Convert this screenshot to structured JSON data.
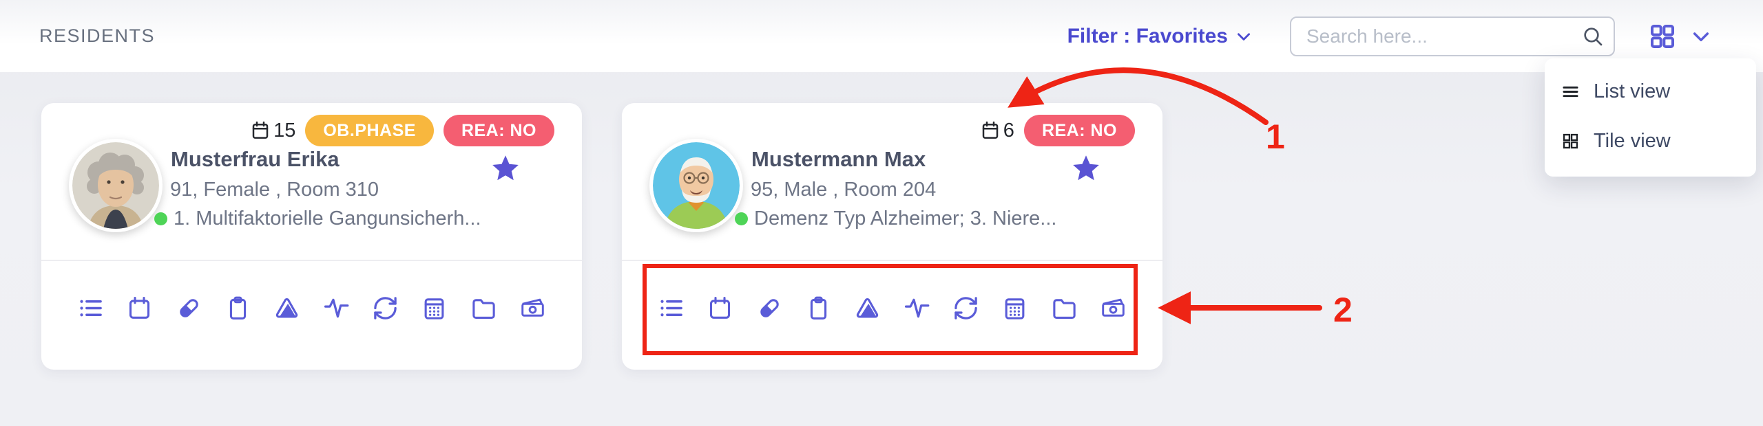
{
  "header": {
    "title": "RESIDENTS",
    "filter": {
      "label": "Filter : Favorites"
    },
    "search": {
      "placeholder": "Search here..."
    }
  },
  "view_menu": {
    "items": [
      {
        "label": "List view",
        "icon": "list-menu-icon"
      },
      {
        "label": "Tile view",
        "icon": "tile-grid-icon"
      }
    ]
  },
  "residents": [
    {
      "name": "Musterfrau Erika",
      "info": "91, Female , Room 310",
      "diagnosis": "1. Multifaktorielle Gangunsicherh...",
      "calendar_count": "15",
      "favorite": true,
      "badges": [
        {
          "label": "OB.PHASE",
          "color": "#f8b73e"
        },
        {
          "label": "REA: NO",
          "color": "#f45e71"
        }
      ]
    },
    {
      "name": "Mustermann Max",
      "info": "95, Male , Room 204",
      "diagnosis": "Demenz Typ Alzheimer; 3. Niere...",
      "calendar_count": "6",
      "favorite": true,
      "badges": [
        {
          "label": "REA: NO",
          "color": "#f45e71"
        }
      ]
    }
  ],
  "card_action_icons": [
    "list-icon",
    "calendar-icon",
    "pill-icon",
    "clipboard-icon",
    "pyramid-icon",
    "pulse-icon",
    "sync-icon",
    "schedule-icon",
    "folder-icon",
    "money-icon"
  ],
  "annotations": {
    "labels": [
      "1",
      "2"
    ],
    "color": "#ee2415"
  },
  "colors": {
    "accent_purple": "#5a5cd8",
    "filter_purple": "#4a49cf",
    "star_purple": "#5a53d3",
    "badge_yellow": "#f8b73e",
    "badge_red": "#f45e71",
    "status_green": "#4ed457",
    "annotation_red": "#ee2415",
    "page_bg": "#eff0f4",
    "card_bg": "#ffffff"
  }
}
